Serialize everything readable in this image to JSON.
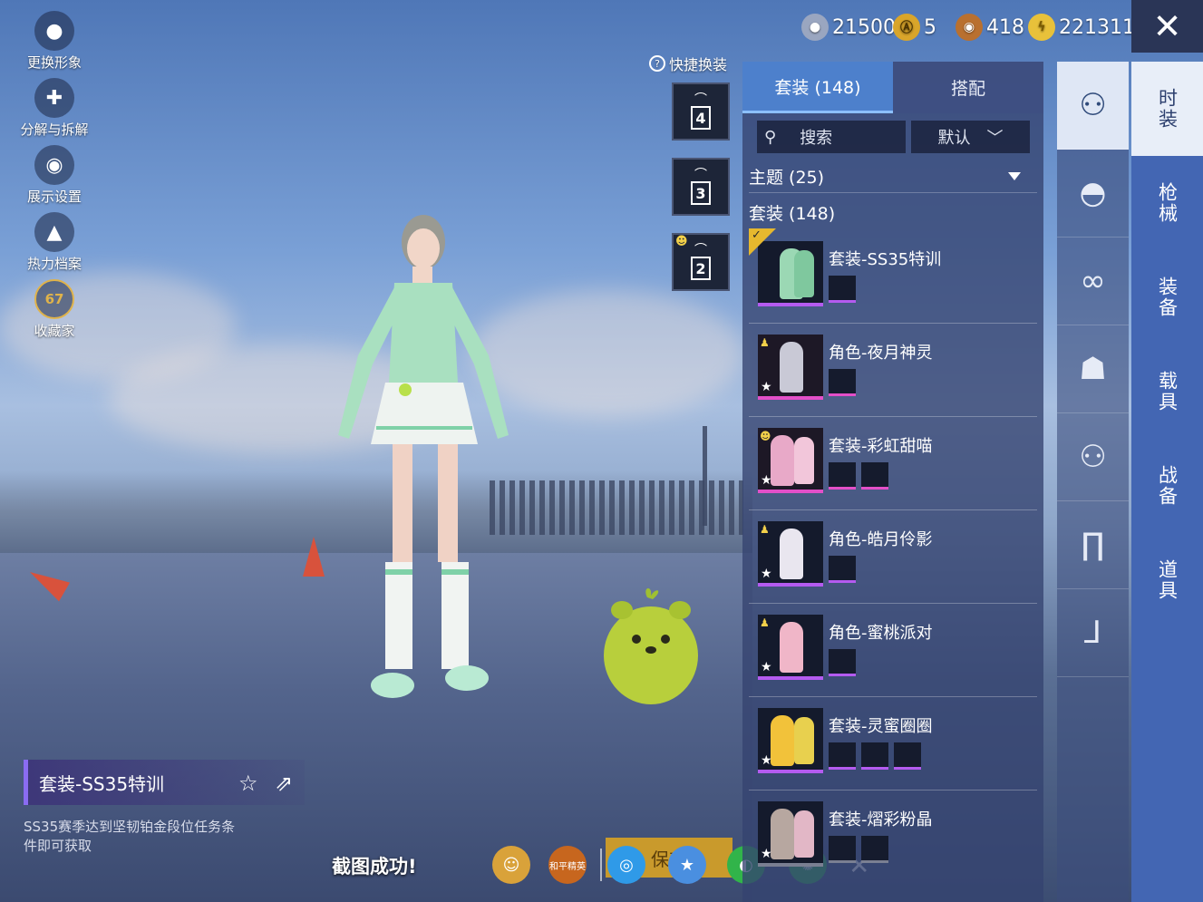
{
  "left_menu": [
    {
      "label": "更换形象",
      "icon": "avatar-icon"
    },
    {
      "label": "分解与拆解",
      "icon": "puzzle-icon"
    },
    {
      "label": "展示设置",
      "icon": "eye-icon"
    },
    {
      "label": "热力档案",
      "icon": "fire-icon"
    },
    {
      "label": "收藏家",
      "icon": "collector-badge-icon",
      "badge": "67"
    }
  ],
  "outfit": {
    "name": "套装-SS35特训",
    "description": "SS35赛季达到坚韧铂金段位任务条件即可获取"
  },
  "share_bar": {
    "message": "截图成功!",
    "save_label": "保存",
    "buttons": [
      "friend-icon",
      "game-logo-icon",
      "qq-icon",
      "qzone-icon",
      "wechat-icon",
      "moments-icon"
    ],
    "game_logo_text": "和平精英"
  },
  "quick_change": {
    "label": "快捷换装",
    "help_mark": "?",
    "slots": [
      "4",
      "3",
      "2"
    ]
  },
  "currency": [
    {
      "icon": "silver-coin-icon",
      "value": "21500",
      "color": "#9aa6c0"
    },
    {
      "icon": "gold-coin-icon",
      "value": "5",
      "color": "#d9a52a"
    },
    {
      "icon": "bronze-coin-icon",
      "value": "418",
      "color": "#b9702f"
    },
    {
      "icon": "lightning-coin-icon",
      "value": "221311",
      "color": "#e8c13a"
    }
  ],
  "panel": {
    "tabs": [
      {
        "label": "套装 (148)",
        "active": true
      },
      {
        "label": "搭配",
        "active": false
      }
    ],
    "search_label": "搜索",
    "sort_label": "默认",
    "theme_label": "主题 (25)",
    "suits_label": "套装 (148)",
    "items": [
      {
        "name": "套装-SS35特训",
        "selected": true
      },
      {
        "name": "角色-夜月神灵"
      },
      {
        "name": "套装-彩虹甜喵"
      },
      {
        "name": "角色-皓月伶影"
      },
      {
        "name": "角色-蜜桃派对"
      },
      {
        "name": "套装-灵蜜圈圈"
      },
      {
        "name": "套装-熠彩粉晶"
      }
    ]
  },
  "slots": [
    "outfit-icon",
    "cap-icon",
    "glasses-icon",
    "mask-icon",
    "outfit-icon",
    "pants-icon",
    "boots-icon"
  ],
  "categories": [
    "时装",
    "枪械",
    "装备",
    "载具",
    "战备",
    "道具"
  ],
  "accent": "#4d80cc"
}
